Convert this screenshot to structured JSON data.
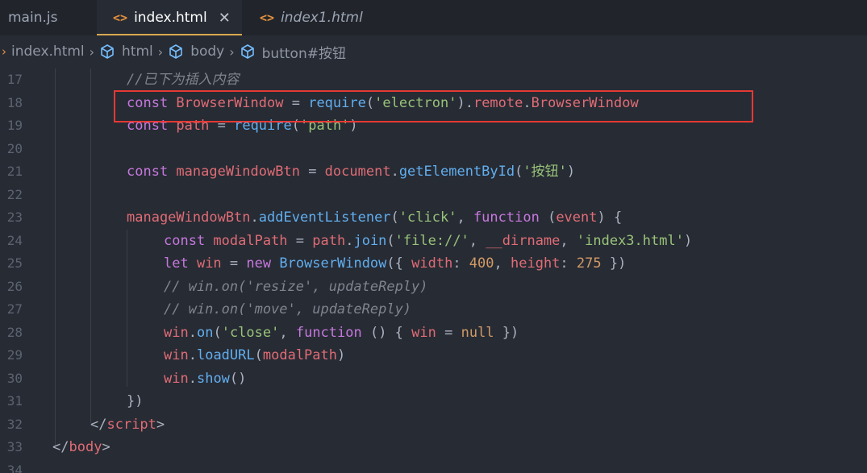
{
  "tabs": [
    {
      "label": "main.js"
    },
    {
      "label": "index.html",
      "active": true,
      "close": "✕"
    },
    {
      "label": "index1.html"
    }
  ],
  "breadcrumb": {
    "file": "index.html",
    "items": [
      "html",
      "body",
      "button#按钮"
    ]
  },
  "colors": {
    "accent": "#d7a84f",
    "highlight": "#e53935",
    "keyword": "#c678dd",
    "variable": "#e06c75",
    "function": "#61afef",
    "string": "#98c379",
    "number": "#d19a66",
    "comment": "#7f848e"
  },
  "lines": [
    {
      "n": "17",
      "indent": 2,
      "tokens": [
        [
          "cm",
          "//已下为插入内容"
        ]
      ]
    },
    {
      "n": "18",
      "indent": 2,
      "tokens": [
        [
          "kw",
          "const "
        ],
        [
          "var",
          "BrowserWindow"
        ],
        [
          "pl",
          " = "
        ],
        [
          "fn",
          "require"
        ],
        [
          "pl",
          "("
        ],
        [
          "str",
          "'electron'"
        ],
        [
          "pl",
          ")."
        ],
        [
          "var",
          "remote"
        ],
        [
          "pl",
          "."
        ],
        [
          "var",
          "BrowserWindow"
        ]
      ]
    },
    {
      "n": "19",
      "indent": 2,
      "tokens": [
        [
          "kw",
          "const "
        ],
        [
          "var",
          "path"
        ],
        [
          "pl",
          " = "
        ],
        [
          "fn",
          "require"
        ],
        [
          "pl",
          "("
        ],
        [
          "str",
          "'path'"
        ],
        [
          "pl",
          ")"
        ]
      ]
    },
    {
      "n": "20",
      "indent": 0,
      "tokens": []
    },
    {
      "n": "21",
      "indent": 2,
      "tokens": [
        [
          "kw",
          "const "
        ],
        [
          "var",
          "manageWindowBtn"
        ],
        [
          "pl",
          " = "
        ],
        [
          "var",
          "document"
        ],
        [
          "pl",
          "."
        ],
        [
          "fn",
          "getElementById"
        ],
        [
          "pl",
          "("
        ],
        [
          "str",
          "'按钮'"
        ],
        [
          "pl",
          ")"
        ]
      ]
    },
    {
      "n": "22",
      "indent": 0,
      "tokens": []
    },
    {
      "n": "23",
      "indent": 2,
      "tokens": [
        [
          "var",
          "manageWindowBtn"
        ],
        [
          "pl",
          "."
        ],
        [
          "fn",
          "addEventListener"
        ],
        [
          "pl",
          "("
        ],
        [
          "str",
          "'click'"
        ],
        [
          "pl",
          ", "
        ],
        [
          "kw",
          "function "
        ],
        [
          "pl",
          "("
        ],
        [
          "var",
          "event"
        ],
        [
          "pl",
          ") {"
        ]
      ]
    },
    {
      "n": "24",
      "indent": 3,
      "tokens": [
        [
          "kw",
          "const "
        ],
        [
          "var",
          "modalPath"
        ],
        [
          "pl",
          " = "
        ],
        [
          "var",
          "path"
        ],
        [
          "pl",
          "."
        ],
        [
          "fn",
          "join"
        ],
        [
          "pl",
          "("
        ],
        [
          "str",
          "'file://'"
        ],
        [
          "pl",
          ", "
        ],
        [
          "var",
          "__dirname"
        ],
        [
          "pl",
          ", "
        ],
        [
          "str",
          "'index3.html'"
        ],
        [
          "pl",
          ")"
        ]
      ]
    },
    {
      "n": "25",
      "indent": 3,
      "tokens": [
        [
          "kw",
          "let "
        ],
        [
          "var",
          "win"
        ],
        [
          "pl",
          " = "
        ],
        [
          "kw",
          "new "
        ],
        [
          "fn",
          "BrowserWindow"
        ],
        [
          "pl",
          "({ "
        ],
        [
          "prop",
          "width"
        ],
        [
          "pl",
          ": "
        ],
        [
          "num",
          "400"
        ],
        [
          "pl",
          ", "
        ],
        [
          "prop",
          "height"
        ],
        [
          "pl",
          ": "
        ],
        [
          "num",
          "275"
        ],
        [
          "pl",
          " })"
        ]
      ]
    },
    {
      "n": "26",
      "indent": 3,
      "tokens": [
        [
          "cm",
          "// win.on('resize', updateReply)"
        ]
      ]
    },
    {
      "n": "27",
      "indent": 3,
      "tokens": [
        [
          "cm",
          "// win.on('move', updateReply)"
        ]
      ]
    },
    {
      "n": "28",
      "indent": 3,
      "tokens": [
        [
          "var",
          "win"
        ],
        [
          "pl",
          "."
        ],
        [
          "fn",
          "on"
        ],
        [
          "pl",
          "("
        ],
        [
          "str",
          "'close'"
        ],
        [
          "pl",
          ", "
        ],
        [
          "kw",
          "function "
        ],
        [
          "pl",
          "() { "
        ],
        [
          "var",
          "win"
        ],
        [
          "pl",
          " = "
        ],
        [
          "num",
          "null"
        ],
        [
          "pl",
          " })"
        ]
      ]
    },
    {
      "n": "29",
      "indent": 3,
      "tokens": [
        [
          "var",
          "win"
        ],
        [
          "pl",
          "."
        ],
        [
          "fn",
          "loadURL"
        ],
        [
          "pl",
          "("
        ],
        [
          "var",
          "modalPath"
        ],
        [
          "pl",
          ")"
        ]
      ]
    },
    {
      "n": "30",
      "indent": 3,
      "tokens": [
        [
          "var",
          "win"
        ],
        [
          "pl",
          "."
        ],
        [
          "fn",
          "show"
        ],
        [
          "pl",
          "()"
        ]
      ]
    },
    {
      "n": "31",
      "indent": 2,
      "tokens": [
        [
          "pl",
          "})"
        ]
      ]
    },
    {
      "n": "32",
      "indent": 1,
      "tokens": [
        [
          "pl",
          "</"
        ],
        [
          "tag",
          "script"
        ],
        [
          "pl",
          ">"
        ]
      ]
    },
    {
      "n": "33",
      "indent": 0,
      "tokens": [
        [
          "pl",
          "</"
        ],
        [
          "tag",
          "body"
        ],
        [
          "pl",
          ">"
        ]
      ]
    },
    {
      "n": "34",
      "indent": 0,
      "tokens": []
    }
  ]
}
